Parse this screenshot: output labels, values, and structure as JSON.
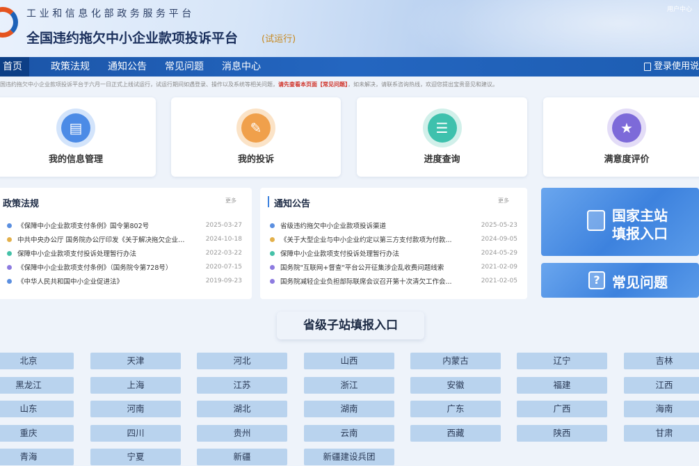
{
  "header": {
    "ministry": "工业和信息化部政务服务平台",
    "title": "全国违约拖欠中小企业款项投诉平台",
    "trial": "(试运行)",
    "user_center": "用户中心"
  },
  "nav": {
    "items": [
      "首页",
      "政策法规",
      "通知公告",
      "常见问题",
      "消息中心"
    ],
    "login": "登录使用说"
  },
  "notice": {
    "before": "国违约拖欠中小企业款项投诉平台于六月一日正式上线试运行，试运行期间如遇登录、操作以及系统等相关问题，",
    "highlight": "请先查看本页面【常见问题】",
    "after": "，如未解决，请联系咨询热线，欢迎您提出宝贵意见和建议。"
  },
  "cards": [
    "我的信息管理",
    "我的投诉",
    "进度查询",
    "满意度评价"
  ],
  "policy": {
    "title": "政策法规",
    "more": "更多",
    "items": [
      {
        "text": "《保障中小企业款项支付条例》国令第802号",
        "date": "2025-03-27"
      },
      {
        "text": "中共中央办公厅 国务院办公厅印发《关于解决拖欠企业账...",
        "date": "2024-10-18"
      },
      {
        "text": "保障中小企业款项支付投诉处理暂行办法",
        "date": "2022-03-22"
      },
      {
        "text": "《保障中小企业款项支付条例》（国务院令第728号）",
        "date": "2020-07-15"
      },
      {
        "text": "《中华人民共和国中小企业促进法》",
        "date": "2019-09-23"
      }
    ]
  },
  "announce": {
    "title": "通知公告",
    "more": "更多",
    "items": [
      {
        "text": "省级违约拖欠中小企业款项投诉渠道",
        "date": "2025-05-23"
      },
      {
        "text": "《关于大型企业与中小企业约定以第三方支付款项为付款...",
        "date": "2024-09-05"
      },
      {
        "text": "保障中小企业款项支付投诉处理暂行办法",
        "date": "2024-05-29"
      },
      {
        "text": "国务院\"互联网+督查\"平台公开征集涉企乱收费问题线索",
        "date": "2021-02-09"
      },
      {
        "text": "国务院减轻企业负担部际联席会议召开第十次清欠工作会...",
        "date": "2021-02-05"
      }
    ]
  },
  "side": {
    "national_line1": "国家主站",
    "national_line2": "填报入口",
    "faq": "常见问题"
  },
  "provinces": {
    "title": "省级子站填报入口",
    "items": [
      "北京",
      "天津",
      "河北",
      "山西",
      "内蒙古",
      "辽宁",
      "吉林",
      "黑龙江",
      "上海",
      "江苏",
      "浙江",
      "安徽",
      "福建",
      "江西",
      "山东",
      "河南",
      "湖北",
      "湖南",
      "广东",
      "广西",
      "海南",
      "重庆",
      "四川",
      "贵州",
      "云南",
      "西藏",
      "陕西",
      "甘肃",
      "青海",
      "宁夏",
      "新疆",
      "新疆建设兵团"
    ]
  },
  "colors": {
    "nav_bg": "#1b55a8",
    "nav_active": "#0d3f86",
    "accent_blue": "#3d82de",
    "province_bg": "#b9d3ee",
    "highlight_red": "#d0332a"
  }
}
